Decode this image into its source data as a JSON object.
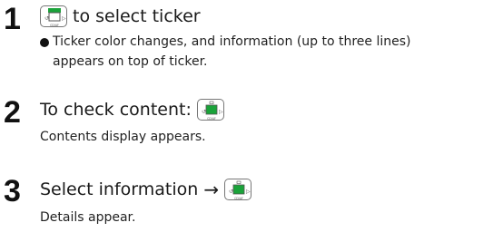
{
  "steps": [
    {
      "number": "1",
      "key_icon": "center-key-green-top",
      "text": "to select ticker",
      "bullet": "Ticker color changes, and information (up to three lines)",
      "bullet_cont": "appears on top of ticker."
    },
    {
      "number": "2",
      "text": "To check content:",
      "key_icon": "center-key-green",
      "sub": "Contents display appears."
    },
    {
      "number": "3",
      "text": "Select information",
      "arrow": "→",
      "key_icon": "center-key-green",
      "sub": "Details appear."
    }
  ],
  "key_label": "CD/AF",
  "colors": {
    "key_green": "#1aa33a",
    "text": "#1a1a1a"
  }
}
